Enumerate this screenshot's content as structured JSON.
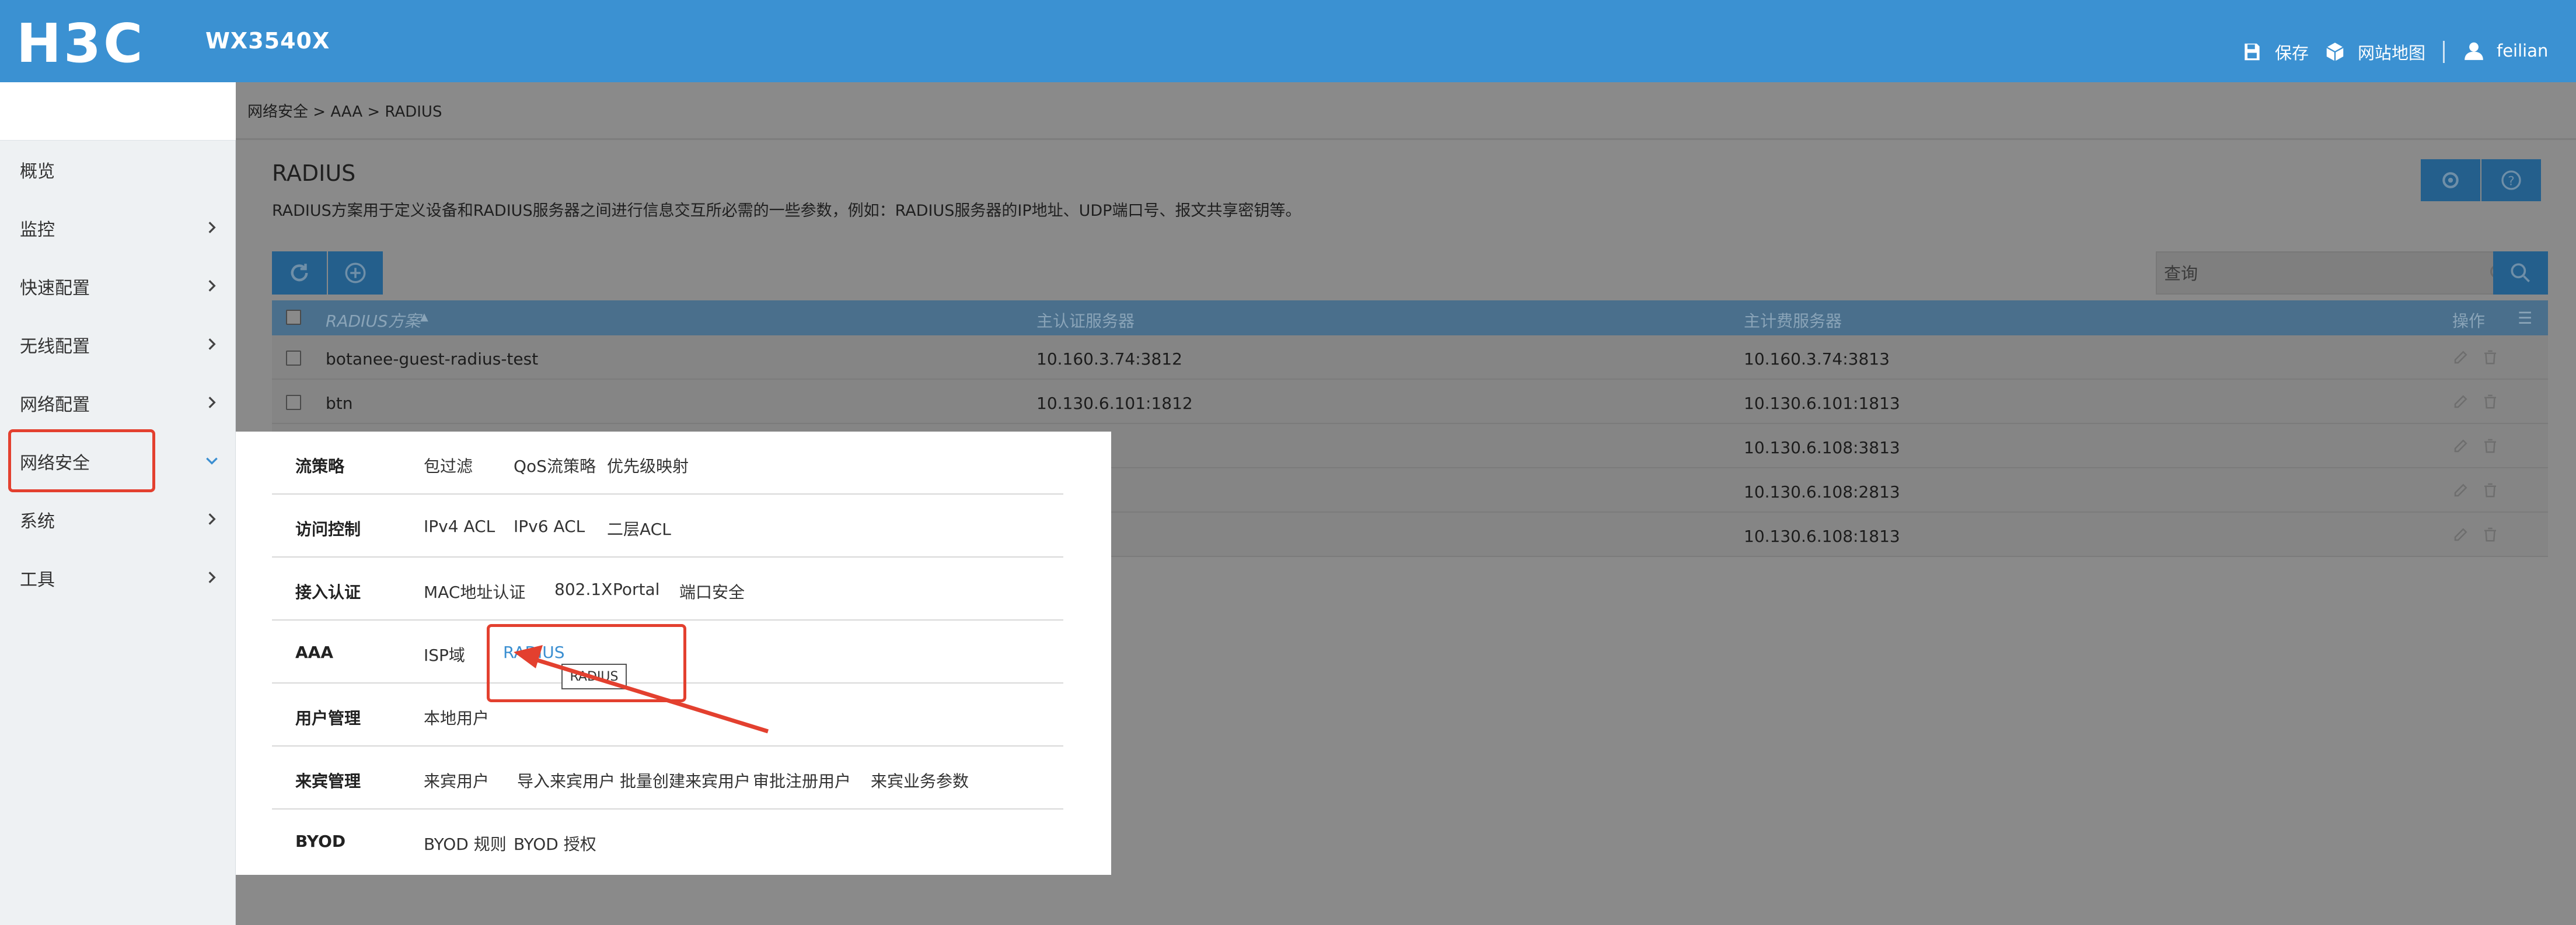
{
  "header": {
    "brand": "H3C",
    "model": "WX3540X",
    "save_label": "保存",
    "sitemap_label": "网站地图",
    "user_name": "feilian"
  },
  "sidebar": {
    "items": [
      {
        "label": "概览",
        "has_chevron": false
      },
      {
        "label": "监控",
        "has_chevron": true
      },
      {
        "label": "快速配置",
        "has_chevron": true
      },
      {
        "label": "无线配置",
        "has_chevron": true
      },
      {
        "label": "网络配置",
        "has_chevron": true
      },
      {
        "label": "网络安全",
        "has_chevron": true,
        "expanded": true
      },
      {
        "label": "系统",
        "has_chevron": true
      },
      {
        "label": "工具",
        "has_chevron": true
      }
    ]
  },
  "breadcrumb": "网络安全 > AAA > RADIUS",
  "page": {
    "title": "RADIUS",
    "description": "RADIUS方案用于定义设备和RADIUS服务器之间进行信息交互所必需的一些参数，例如：RADIUS服务器的IP地址、UDP端口号、报文共享密钥等。"
  },
  "search": {
    "placeholder": "查询"
  },
  "table": {
    "columns": [
      "RADIUS方案",
      "主认证服务器",
      "主计费服务器",
      "操作"
    ],
    "rows": [
      {
        "scheme": "botanee-guest-radius-test",
        "auth": "10.160.3.74:3812",
        "acct": "10.160.3.74:3813"
      },
      {
        "scheme": "btn",
        "auth": "10.130.6.101:1812",
        "acct": "10.130.6.101:1813"
      },
      {
        "scheme": "",
        "auth": "08:3812",
        "acct": "10.130.6.108:3813"
      },
      {
        "scheme": "",
        "auth": "08:2812",
        "acct": "10.130.6.108:2813"
      },
      {
        "scheme": "",
        "auth": "08:1812",
        "acct": "10.130.6.108:1813"
      }
    ]
  },
  "menu": {
    "rows": [
      {
        "category": "流策略",
        "items": [
          "包过滤",
          "QoS流策略",
          "优先级映射"
        ]
      },
      {
        "category": "访问控制",
        "items": [
          "IPv4 ACL",
          "IPv6 ACL",
          "二层ACL"
        ]
      },
      {
        "category": "接入认证",
        "items": [
          "MAC地址认证",
          "802.1X",
          "Portal",
          "端口安全"
        ]
      },
      {
        "category": "AAA",
        "items": [
          "ISP域",
          "RADIUS"
        ]
      },
      {
        "category": "用户管理",
        "items": [
          "本地用户"
        ]
      },
      {
        "category": "来宾管理",
        "items": [
          "来宾用户",
          "导入来宾用户",
          "批量创建来宾用户",
          "审批注册用户",
          "来宾业务参数"
        ]
      },
      {
        "category": "BYOD",
        "items": [
          "BYOD 规则",
          "BYOD 授权"
        ]
      }
    ],
    "tooltip": "RADIUS"
  },
  "colors": {
    "header_bg": "#3b91d2",
    "accent": "#3b8fd1",
    "highlight": "#e3402f"
  }
}
